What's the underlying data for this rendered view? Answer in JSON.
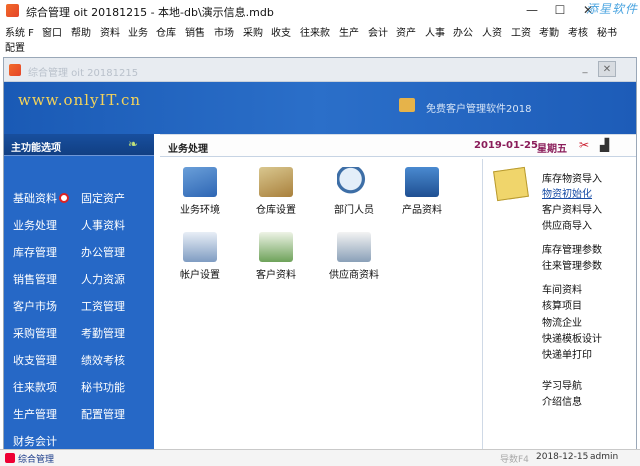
{
  "window": {
    "title": "综合管理 oit 20181215 - 本地-db\\演示信息.mdb",
    "watermark": "添星软件",
    "minimize": "—",
    "maximize": "☐",
    "close": "✕"
  },
  "menubar": {
    "items": [
      "系统 F",
      "窗口",
      "帮助",
      "资料",
      "业务",
      "仓库",
      "销售",
      "市场",
      "采购",
      "收支",
      "往来款",
      "生产",
      "会计",
      "资产",
      "人事",
      "办公",
      "人资",
      "工资",
      "考勤",
      "考核",
      "秘书"
    ],
    "second_row": "配置"
  },
  "child_window": {
    "title": "综合管理 oit 20181215",
    "minimize": "_",
    "close": "✕"
  },
  "banner": {
    "url": "www.onlyIT.cn",
    "promo": "免费客户管理软件2018"
  },
  "left_panel": {
    "title": "主功能选项",
    "items": [
      "基础资料",
      "固定资产",
      "业务处理",
      "人事资料",
      "库存管理",
      "办公管理",
      "销售管理",
      "人力资源",
      "客户市场",
      "工资管理",
      "采购管理",
      "考勤管理",
      "收支管理",
      "绩效考核",
      "往来款项",
      "秘书功能",
      "生产管理",
      "配置管理",
      "财务会计"
    ]
  },
  "main": {
    "title": "业务处理",
    "date": "2019-01-25",
    "weekday": "星期五",
    "tiles": [
      {
        "label": "业务环境",
        "icon": "notebook-icon"
      },
      {
        "label": "仓库设置",
        "icon": "warehouse-icon"
      },
      {
        "label": "部门人员",
        "icon": "magnifier-icon"
      },
      {
        "label": "产品资料",
        "icon": "calculator-icon"
      },
      {
        "label": "帐户设置",
        "icon": "ledger-icon"
      },
      {
        "label": "客户资料",
        "icon": "customer-icon"
      },
      {
        "label": "供应商资料",
        "icon": "supplier-icon"
      }
    ],
    "right_links": [
      "库存物资导入",
      "物资初始化",
      "客户资料导入",
      "供应商导入",
      "库存管理参数",
      "往来管理参数",
      "车间资料",
      "核算项目",
      "物流企业",
      "快递模板设计",
      "快递单打印",
      "学习导航",
      "介绍信息"
    ]
  },
  "statusbar": {
    "left": "综合管理",
    "key": "导数F4",
    "date": "2018-12-15",
    "user": "admin"
  }
}
